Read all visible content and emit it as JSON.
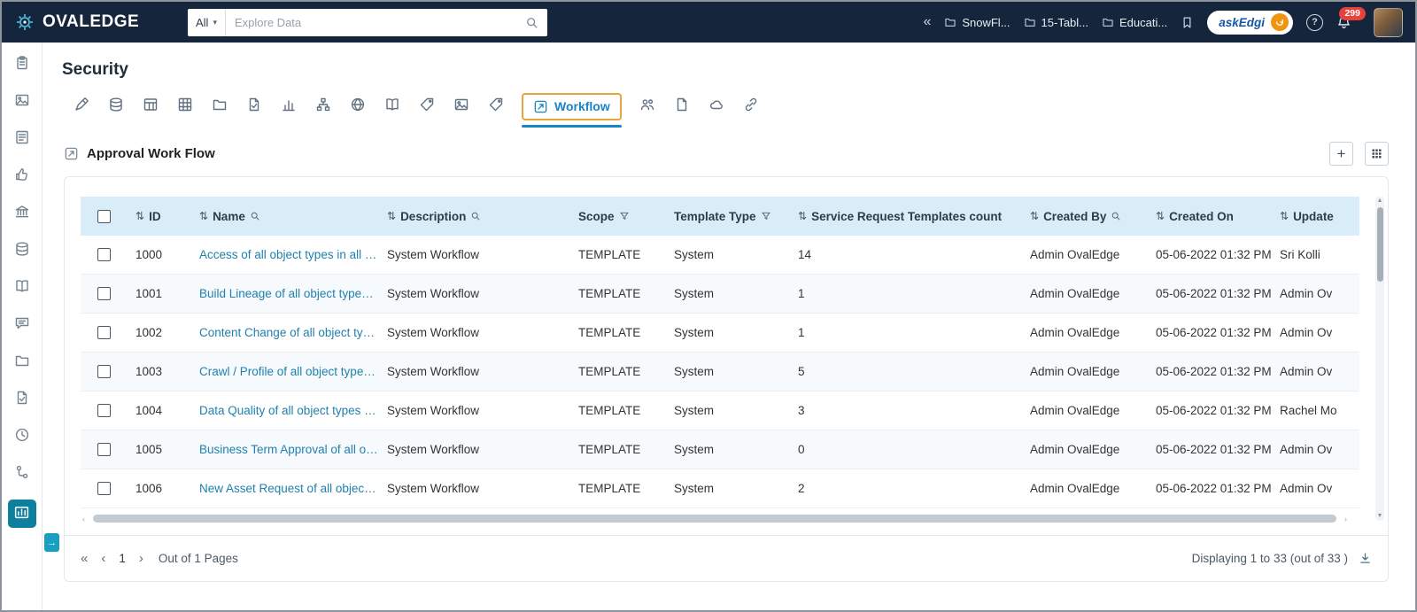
{
  "colors": {
    "topbar_bg": "#15263c",
    "accent_orange": "#eba33c",
    "accent_blue": "#1b83c7",
    "link_blue": "#2180ad",
    "header_bg": "#d9edf8",
    "badge_red": "#e8413c",
    "active_teal": "#0f7f9e"
  },
  "topbar": {
    "logo_text": "OVALEDGE",
    "search": {
      "scope_label": "All",
      "placeholder": "Explore Data"
    },
    "collapse_icon": "«",
    "recent_items": [
      "SnowFl...",
      "15-Tabl...",
      "Educati..."
    ],
    "askedgi_label": "askEdgi",
    "help_label": "?",
    "notification_count": "299"
  },
  "sidebar": {
    "items": [
      {
        "icon": "clipboard",
        "name": "clipboard-icon"
      },
      {
        "icon": "image",
        "name": "media-icon"
      },
      {
        "icon": "list",
        "name": "report-list-icon"
      },
      {
        "icon": "thumb",
        "name": "endorsement-icon"
      },
      {
        "icon": "bank",
        "name": "governance-icon"
      },
      {
        "icon": "database",
        "name": "data-stores-icon"
      },
      {
        "icon": "book",
        "name": "glossary-icon"
      },
      {
        "icon": "chat",
        "name": "collaboration-icon"
      },
      {
        "icon": "folder",
        "name": "projects-icon"
      },
      {
        "icon": "file-check",
        "name": "compliance-icon"
      },
      {
        "icon": "clock",
        "name": "scheduler-icon"
      },
      {
        "icon": "tools",
        "name": "advanced-tools-icon"
      },
      {
        "icon": "building-chart",
        "name": "governance-dashboard-icon",
        "active": true
      }
    ],
    "toggle_icon": "→"
  },
  "page": {
    "title": "Security"
  },
  "tabs": {
    "icons_before": [
      {
        "icon": "rocket",
        "name": "crawler"
      },
      {
        "icon": "database",
        "name": "databases"
      },
      {
        "icon": "table",
        "name": "tables"
      },
      {
        "icon": "grid",
        "name": "columns"
      },
      {
        "icon": "folder",
        "name": "files"
      },
      {
        "icon": "file-check",
        "name": "queries"
      },
      {
        "icon": "chart",
        "name": "reports"
      },
      {
        "icon": "hierarchy",
        "name": "data-lineage"
      },
      {
        "icon": "globe",
        "name": "domains"
      },
      {
        "icon": "book",
        "name": "codes"
      },
      {
        "icon": "tag",
        "name": "tags"
      },
      {
        "icon": "image",
        "name": "stories"
      },
      {
        "icon": "tag",
        "name": "labels"
      }
    ],
    "active": {
      "label": "Workflow",
      "icon": "workflow"
    },
    "icons_after": [
      {
        "icon": "users",
        "name": "users"
      },
      {
        "icon": "file",
        "name": "documents"
      },
      {
        "icon": "cloud",
        "name": "api"
      },
      {
        "icon": "link",
        "name": "connections"
      }
    ]
  },
  "section": {
    "title": "Approval Work Flow",
    "add_label": "+"
  },
  "table": {
    "columns": [
      {
        "key": "id",
        "label": "ID",
        "sort": true
      },
      {
        "key": "name",
        "label": "Name",
        "sort": true,
        "search": true
      },
      {
        "key": "description",
        "label": "Description",
        "sort": true,
        "search": true
      },
      {
        "key": "scope",
        "label": "Scope",
        "filter": true
      },
      {
        "key": "template_type",
        "label": "Template Type",
        "filter": true
      },
      {
        "key": "count",
        "label": "Service Request Templates count",
        "sort": true
      },
      {
        "key": "created_by",
        "label": "Created By",
        "sort": true,
        "search": true
      },
      {
        "key": "created_on",
        "label": "Created On",
        "sort": true
      },
      {
        "key": "updated",
        "label": "Update",
        "sort": true
      }
    ],
    "sort_glyph": "⇅",
    "rows": [
      {
        "id": "1000",
        "name": "Access of all object types in all c...",
        "description": "System Workflow",
        "scope": "TEMPLATE",
        "template_type": "System",
        "count": "14",
        "created_by": "Admin OvalEdge",
        "created_on": "05-06-2022 01:32 PM",
        "updated": "Sri Kolli"
      },
      {
        "id": "1001",
        "name": "Build Lineage of all object types i...",
        "description": "System Workflow",
        "scope": "TEMPLATE",
        "template_type": "System",
        "count": "1",
        "created_by": "Admin OvalEdge",
        "created_on": "05-06-2022 01:32 PM",
        "updated": "Admin Ov"
      },
      {
        "id": "1002",
        "name": "Content Change of all object typ...",
        "description": "System Workflow",
        "scope": "TEMPLATE",
        "template_type": "System",
        "count": "1",
        "created_by": "Admin OvalEdge",
        "created_on": "05-06-2022 01:32 PM",
        "updated": "Admin Ov"
      },
      {
        "id": "1003",
        "name": "Crawl / Profile of all object types...",
        "description": "System Workflow",
        "scope": "TEMPLATE",
        "template_type": "System",
        "count": "5",
        "created_by": "Admin OvalEdge",
        "created_on": "05-06-2022 01:32 PM",
        "updated": "Admin Ov"
      },
      {
        "id": "1004",
        "name": "Data Quality of all object types in...",
        "description": "System Workflow",
        "scope": "TEMPLATE",
        "template_type": "System",
        "count": "3",
        "created_by": "Admin OvalEdge",
        "created_on": "05-06-2022 01:32 PM",
        "updated": "Rachel Mo"
      },
      {
        "id": "1005",
        "name": "Business Term Approval of all ob...",
        "description": "System Workflow",
        "scope": "TEMPLATE",
        "template_type": "System",
        "count": "0",
        "created_by": "Admin OvalEdge",
        "created_on": "05-06-2022 01:32 PM",
        "updated": "Admin Ov"
      },
      {
        "id": "1006",
        "name": "New Asset Request of all object ...",
        "description": "System Workflow",
        "scope": "TEMPLATE",
        "template_type": "System",
        "count": "2",
        "created_by": "Admin OvalEdge",
        "created_on": "05-06-2022 01:32 PM",
        "updated": "Admin Ov"
      }
    ]
  },
  "pagination": {
    "first_icon": "«",
    "prev_icon": "‹",
    "page": "1",
    "next_icon": "›",
    "pages_label": "Out of 1 Pages",
    "displaying_label": "Displaying 1 to 33  (out of 33 )"
  }
}
